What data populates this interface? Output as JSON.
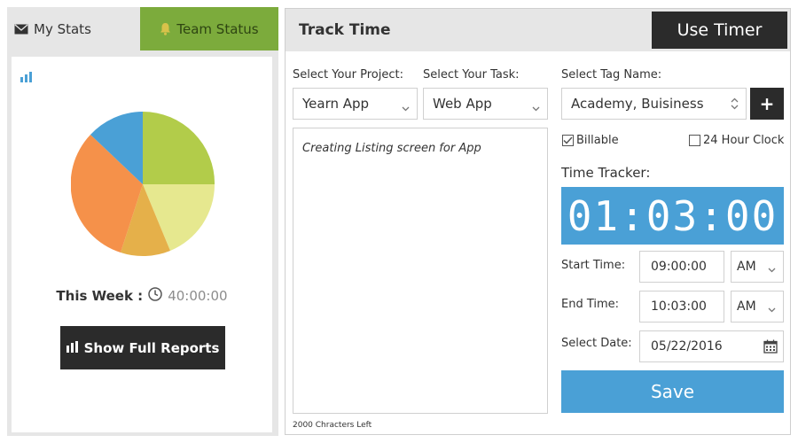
{
  "left_panel": {
    "tab_my_stats": "My Stats",
    "tab_team_status": "Team Status",
    "this_week_label": "This Week :",
    "this_week_value": "40:00:00",
    "show_reports_label": "Show Full Reports",
    "pie_colors": [
      "#b2cc4a",
      "#e6e88f",
      "#e5b04a",
      "#f5914a",
      "#4aa0d6"
    ]
  },
  "track_time": {
    "title": "Track Time",
    "use_timer_label": "Use Timer",
    "project_label": "Select Your Project:",
    "project_value": "Yearn App",
    "task_label": "Select Your Task:",
    "task_value": "Web App",
    "tag_label": "Select Tag Name:",
    "tag_value": "Academy, Buisiness",
    "add_tag_label": "+",
    "description": "Creating Listing screen for App",
    "chars_left": "2000 Chracters Left",
    "billable_label": "Billable",
    "clock24_label": "24 Hour Clock",
    "tracker_label": "Time Tracker:",
    "timer_value": "01:03:00",
    "start_time_label": "Start Time:",
    "start_time_value": "09:00:00",
    "start_ampm": "AM",
    "end_time_label": "End Time:",
    "end_time_value": "10:03:00",
    "end_ampm": "AM",
    "date_label": "Select Date:",
    "date_value": "05/22/2016",
    "save_label": "Save"
  },
  "colors": {
    "team_tab_green": "#7cab3c",
    "accent_blue": "#4aa0d6",
    "dark_button": "#2b2b2b"
  }
}
